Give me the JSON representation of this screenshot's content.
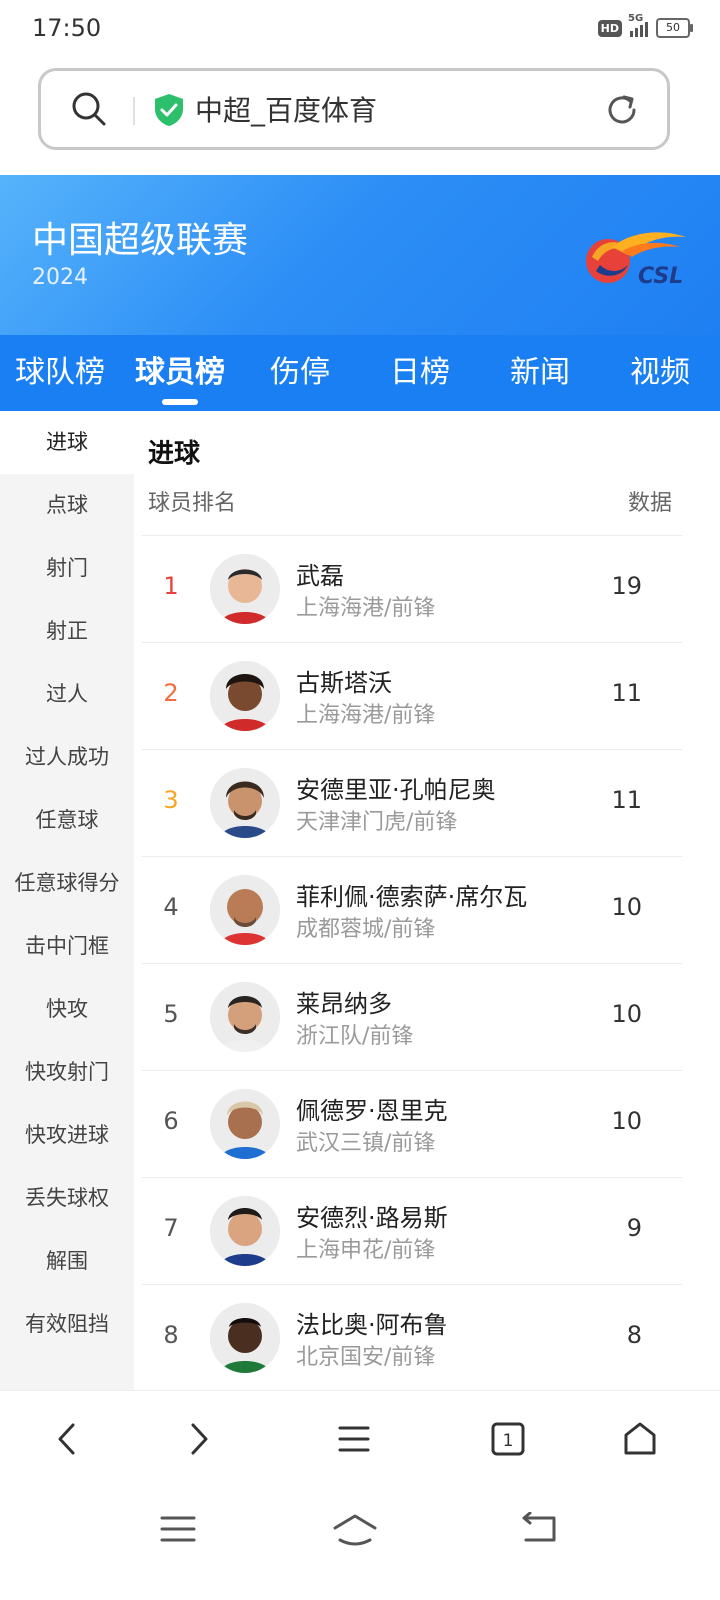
{
  "status": {
    "time": "17:50",
    "hd": "HD",
    "network": "5G",
    "battery": "50"
  },
  "address_bar": {
    "title": "中超_百度体育"
  },
  "banner": {
    "league_name": "中国超级联赛",
    "year": "2024",
    "logo_text": "CSL"
  },
  "tabs": [
    {
      "label": "球队榜",
      "active": false
    },
    {
      "label": "球员榜",
      "active": true
    },
    {
      "label": "伤停",
      "active": false
    },
    {
      "label": "日榜",
      "active": false
    },
    {
      "label": "新闻",
      "active": false
    },
    {
      "label": "视频",
      "active": false
    }
  ],
  "sidebar": [
    "进球",
    "点球",
    "射门",
    "射正",
    "过人",
    "过人成功",
    "任意球",
    "任意球得分",
    "击中门框",
    "快攻",
    "快攻射门",
    "快攻进球",
    "丢失球权",
    "解围",
    "有效阻挡"
  ],
  "main": {
    "category": "进球",
    "header_rank": "球员排名",
    "header_data": "数据",
    "rows": [
      {
        "rank": "1",
        "name": "武磊",
        "team": "上海海港/前锋",
        "value": "19"
      },
      {
        "rank": "2",
        "name": "古斯塔沃",
        "team": "上海海港/前锋",
        "value": "11"
      },
      {
        "rank": "3",
        "name": "安德里亚·孔帕尼奥",
        "team": "天津津门虎/前锋",
        "value": "11"
      },
      {
        "rank": "4",
        "name": "菲利佩·德索萨·席尔瓦",
        "team": "成都蓉城/前锋",
        "value": "10"
      },
      {
        "rank": "5",
        "name": "莱昂纳多",
        "team": "浙江队/前锋",
        "value": "10"
      },
      {
        "rank": "6",
        "name": "佩德罗·恩里克",
        "team": "武汉三镇/前锋",
        "value": "10"
      },
      {
        "rank": "7",
        "name": "安德烈·路易斯",
        "team": "上海申花/前锋",
        "value": "9"
      },
      {
        "rank": "8",
        "name": "法比奥·阿布鲁",
        "team": "北京国安/前锋",
        "value": "8"
      }
    ]
  },
  "toolbar": {
    "tabs_count": "1"
  },
  "colors": {
    "accent": "#1a7ff3",
    "rank1": "#e8413a",
    "rank2": "#f26d3d",
    "rank3": "#f5a623",
    "secure": "#2dbf6c"
  }
}
